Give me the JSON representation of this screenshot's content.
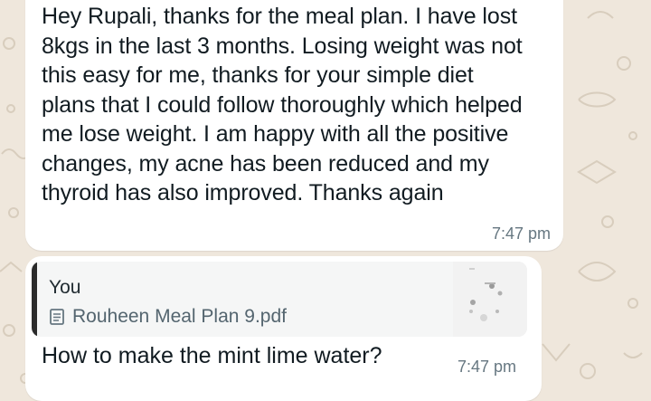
{
  "messages": [
    {
      "text": "Hey Rupali, thanks for the meal plan. I have lost 8kgs in the last 3 months. Losing weight was not this easy for me, thanks for your simple diet plans that I could follow thoroughly which helped me lose weight. I am happy with all the positive changes, my acne has been reduced and my thyroid has also improved. Thanks again",
      "time": "7:47 pm"
    },
    {
      "reply_to": {
        "author": "You",
        "file_name": "Rouheen Meal Plan 9.pdf",
        "icon": "document-icon",
        "thumbnail": "pdf-thumbnail"
      },
      "text": "How to make the mint lime water?",
      "time": "7:47 pm"
    }
  ],
  "colors": {
    "background": "#efe7dc",
    "bubble": "#ffffff",
    "quote_background": "#f5f6f6",
    "quote_bar": "#2b2b2b",
    "timestamp": "#667781"
  }
}
